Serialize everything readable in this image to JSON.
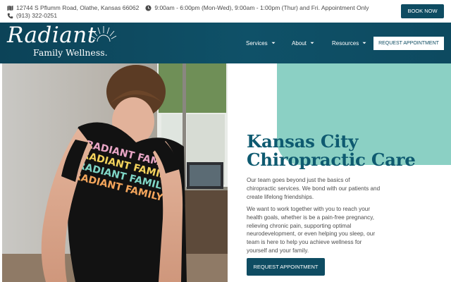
{
  "topbar": {
    "address": "12744 S Pflumm Road, Olathe, Kansas 66062",
    "hours": "9:00am - 6:00pm (Mon-Wed), 9:00am - 1:00pm (Thur) and Fri. Appointment Only",
    "phone": "(913) 322-0251",
    "book_now_label": "BOOK NOW",
    "icons": [
      "map-icon",
      "clock-icon",
      "phone-icon"
    ]
  },
  "header": {
    "logo_script": "Radiant",
    "logo_sub": "Family Wellness.",
    "nav": [
      {
        "label": "Services"
      },
      {
        "label": "About"
      },
      {
        "label": "Resources"
      }
    ],
    "cta_label": "REQUEST APPOINTMENT"
  },
  "hero": {
    "photo": {
      "shirt_lines": [
        "RADIANT FAMILY",
        "RADIANT FAMILY",
        "RADIANT FAMILY",
        "RADIANT FAMILY"
      ],
      "shirt_colors": [
        "#e9a6c6",
        "#f2d25c",
        "#7fd6c6",
        "#f4a55b"
      ]
    },
    "title_line1": "Kansas City",
    "title_line2": "Chiropractic Care",
    "paragraph1": "Our team goes beyond just the basics of chiropractic services. We bond with our patients and create lifelong friendships.",
    "paragraph2": "We want to work together with you to reach your health goals, whether is be a pain-free pregnancy, relieving chronic pain, supporting optimal neurodevelopment, or even helping you sleep, our team is here to help you achieve wellness for yourself and your family.",
    "cta_label": "REQUEST APPOINTMENT"
  },
  "colors": {
    "brand_dark_teal": "#0e4c62",
    "title_teal": "#0e5a70",
    "accent_mint": "#8bd0c4"
  }
}
